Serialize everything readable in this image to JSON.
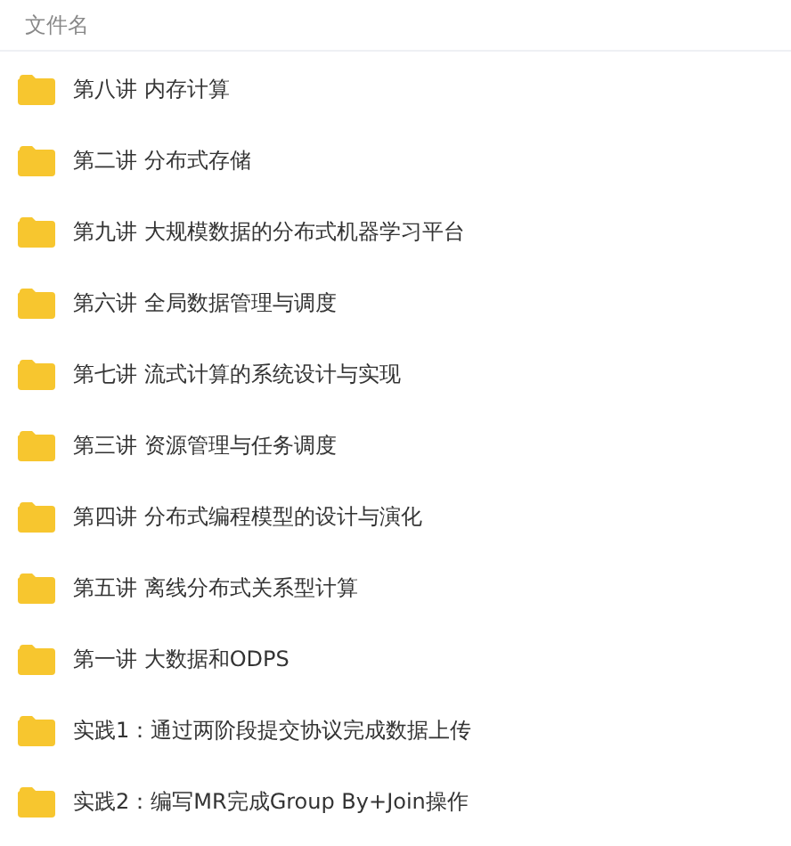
{
  "header": {
    "label": "文件名"
  },
  "files": [
    {
      "name": "第八讲 内存计算",
      "kind": "folder"
    },
    {
      "name": "第二讲 分布式存储",
      "kind": "folder"
    },
    {
      "name": "第九讲 大规模数据的分布式机器学习平台",
      "kind": "folder"
    },
    {
      "name": "第六讲 全局数据管理与调度",
      "kind": "folder"
    },
    {
      "name": "第七讲 流式计算的系统设计与实现",
      "kind": "folder"
    },
    {
      "name": "第三讲 资源管理与任务调度",
      "kind": "folder"
    },
    {
      "name": "第四讲 分布式编程模型的设计与演化",
      "kind": "folder"
    },
    {
      "name": "第五讲 离线分布式关系型计算",
      "kind": "folder"
    },
    {
      "name": "第一讲 大数据和ODPS",
      "kind": "folder"
    },
    {
      "name": "实践1：通过两阶段提交协议完成数据上传",
      "kind": "folder"
    },
    {
      "name": "实践2：编写MR完成Group By+Join操作",
      "kind": "folder"
    }
  ]
}
